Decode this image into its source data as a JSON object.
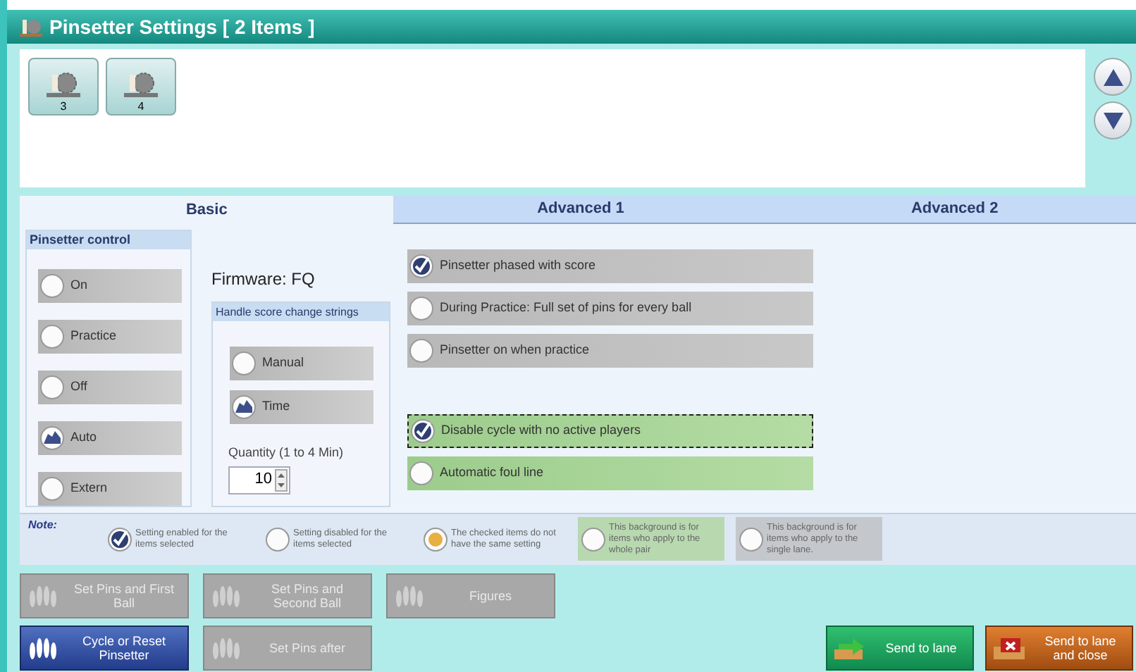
{
  "window": {
    "title": "Pinsetter Settings [ 2 Items ]"
  },
  "items": [
    {
      "label": "3"
    },
    {
      "label": "4"
    }
  ],
  "tabs": [
    {
      "label": "Basic",
      "selected": true
    },
    {
      "label": "Advanced 1",
      "selected": false
    },
    {
      "label": "Advanced 2",
      "selected": false
    }
  ],
  "pinsetter_control": {
    "title": "Pinsetter control",
    "options": [
      {
        "label": "On",
        "selected": false
      },
      {
        "label": "Practice",
        "selected": false
      },
      {
        "label": "Off",
        "selected": false
      },
      {
        "label": "Auto",
        "selected": true
      },
      {
        "label": "Extern",
        "selected": false
      }
    ]
  },
  "firmware": "Firmware: FQ",
  "handle_group": {
    "title": "Handle score change strings",
    "options": [
      {
        "label": "Manual",
        "selected": false
      },
      {
        "label": "Time",
        "selected": true
      }
    ],
    "quantity_label": "Quantity (1 to 4 Min)",
    "quantity_value": "10"
  },
  "settings": [
    {
      "label": "Pinsetter phased with score",
      "checked": true,
      "kind": "lane",
      "focused": false
    },
    {
      "label": "During Practice: Full set of pins for every ball",
      "checked": false,
      "kind": "lane",
      "focused": false
    },
    {
      "label": "Pinsetter on when practice",
      "checked": false,
      "kind": "lane",
      "focused": false
    },
    {
      "label": "Disable cycle with no active players",
      "checked": true,
      "kind": "pair",
      "focused": true
    },
    {
      "label": "Automatic foul line",
      "checked": false,
      "kind": "pair",
      "focused": false
    }
  ],
  "note": {
    "title": "Note:",
    "legend": [
      {
        "kind": "enabled",
        "text": "Setting enabled for the items selected"
      },
      {
        "kind": "disabled",
        "text": "Setting disabled for the items selected"
      },
      {
        "kind": "mixed",
        "text": "The checked items do not have the same setting"
      },
      {
        "kind": "pair",
        "text": "This background is for items who apply to the whole pair"
      },
      {
        "kind": "lane",
        "text": "This background is for items who apply to the single lane."
      }
    ]
  },
  "actions": [
    {
      "label": "Set Pins and First Ball",
      "disabled": true
    },
    {
      "label": "Set Pins and Second Ball",
      "disabled": true
    },
    {
      "label": "Figures",
      "disabled": true
    },
    {
      "label": "Cycle or Reset Pinsetter",
      "disabled": false
    },
    {
      "label": "Set Pins after",
      "disabled": true
    }
  ],
  "send_buttons": [
    {
      "label": "Send to lane",
      "kind": "send"
    },
    {
      "label": "Send to lane and close",
      "kind": "close"
    }
  ]
}
